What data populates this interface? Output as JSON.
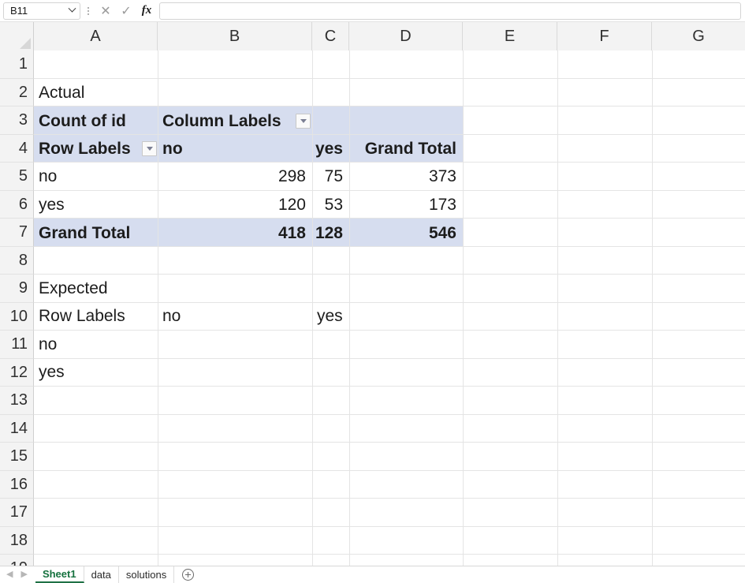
{
  "formula_bar": {
    "name_box_value": "B11",
    "name_box_caret_icon": "chevron-down-icon",
    "kebab_icon": "more-options-icon",
    "cancel_icon": "✕",
    "confirm_icon": "✓",
    "function_icon": "fx",
    "formula_value": "",
    "formula_placeholder": ""
  },
  "grid": {
    "columns": [
      "A",
      "B",
      "C",
      "D",
      "E",
      "F",
      "G"
    ],
    "rows": [
      "1",
      "2",
      "3",
      "4",
      "5",
      "6",
      "7",
      "8",
      "9",
      "10",
      "11",
      "12",
      "13",
      "14",
      "15",
      "16",
      "17",
      "18",
      "19"
    ],
    "cells": {
      "A2": "Actual",
      "A3": "Count of id",
      "B3": "Column Labels",
      "A4": "Row Labels",
      "B4": "no",
      "C4": "yes",
      "D4": "Grand Total",
      "A5": "no",
      "B5": "298",
      "C5": "75",
      "D5": "373",
      "A6": "yes",
      "B6": "120",
      "C6": "53",
      "D6": "173",
      "A7": "Grand Total",
      "B7": "418",
      "C7": "128",
      "D7": "546",
      "A9": "Expected",
      "A10": "Row Labels",
      "B10": "no",
      "C10": "yes",
      "A11": "no",
      "A12": "yes"
    },
    "filter_buttons": {
      "column_labels_filter": "filter-dropdown-icon",
      "row_labels_filter": "filter-dropdown-icon"
    },
    "colors": {
      "pivot_header_fill": "#d6ddef",
      "header_fill": "#f3f3f3",
      "gridline": "#e4e4e4",
      "active_tab_accent": "#1f7145"
    }
  },
  "tabs": {
    "prev_icon": "◀",
    "next_icon": "▶",
    "sheets": [
      {
        "label": "Sheet1",
        "active": true
      },
      {
        "label": "data",
        "active": false
      },
      {
        "label": "solutions",
        "active": false
      }
    ],
    "add_sheet_icon": "add-sheet-icon"
  }
}
